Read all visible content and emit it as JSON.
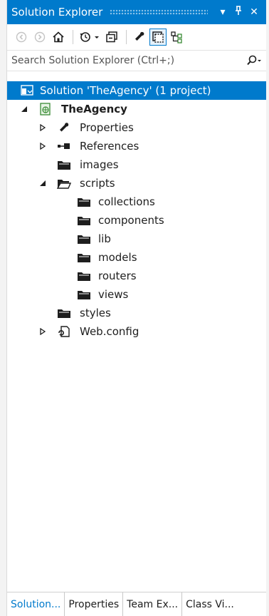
{
  "titlebar": {
    "title": "Solution Explorer",
    "dropdown_icon": "▾",
    "pin_icon": "pin-icon",
    "close_icon": "✕"
  },
  "toolbar": {
    "icons": [
      "back-icon",
      "forward-icon",
      "home-icon",
      "history-icon",
      "collapse-all-icon",
      "properties-wrench-icon",
      "show-all-files-icon",
      "class-view-icon"
    ]
  },
  "search": {
    "placeholder": "Search Solution Explorer (Ctrl+;)"
  },
  "tree": {
    "solution": "Solution 'TheAgency' (1 project)",
    "project": "TheAgency",
    "properties": "Properties",
    "references": "References",
    "images": "images",
    "scripts": "scripts",
    "collections": "collections",
    "components": "components",
    "lib": "lib",
    "models": "models",
    "routers": "routers",
    "views": "views",
    "styles": "styles",
    "webconfig": "Web.config"
  },
  "tabs": {
    "solution": "Solution...",
    "properties": "Properties",
    "team": "Team Ex...",
    "classview": "Class Vi..."
  },
  "colors": {
    "accent": "#007acc",
    "selection_bg": "#007acc",
    "folder": "#1e1e1e"
  }
}
